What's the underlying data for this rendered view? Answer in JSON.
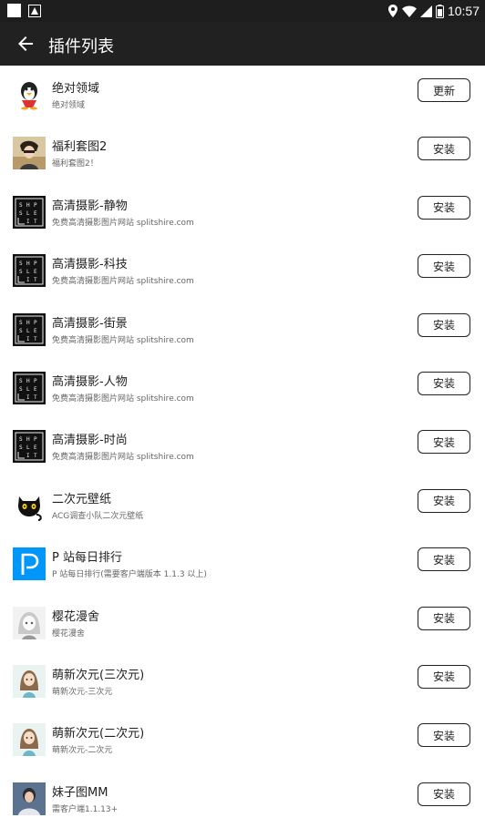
{
  "status_bar": {
    "time": "10:57"
  },
  "toolbar": {
    "title": "插件列表"
  },
  "plugins": [
    {
      "name": "绝对领域",
      "desc": "绝对领域",
      "action": "更新",
      "icon": "penguin-icon"
    },
    {
      "name": "福利套图2",
      "desc": "福利套图2！",
      "action": "安装",
      "icon": "photo-girl-icon"
    },
    {
      "name": "高清摄影-静物",
      "desc": "免费高清摄影图片网站 splitshire.com",
      "action": "安装",
      "icon": "splitshire-logo-icon"
    },
    {
      "name": "高清摄影-科技",
      "desc": "免费高清摄影图片网站 splitshire.com",
      "action": "安装",
      "icon": "splitshire-logo-icon"
    },
    {
      "name": "高清摄影-街景",
      "desc": "免费高清摄影图片网站 splitshire.com",
      "action": "安装",
      "icon": "splitshire-logo-icon"
    },
    {
      "name": "高清摄影-人物",
      "desc": "免费高清摄影图片网站 splitshire.com",
      "action": "安装",
      "icon": "splitshire-logo-icon"
    },
    {
      "name": "高清摄影-时尚",
      "desc": "免费高清摄影图片网站 splitshire.com",
      "action": "安装",
      "icon": "splitshire-logo-icon"
    },
    {
      "name": "二次元壁纸",
      "desc": "ACG调查小队二次元壁纸",
      "action": "安装",
      "icon": "black-cat-icon"
    },
    {
      "name": "P 站每日排行",
      "desc": "P 站每日排行(需要客户端版本 1.1.3 以上)",
      "action": "安装",
      "icon": "pixiv-p-icon"
    },
    {
      "name": "樱花漫舍",
      "desc": "樱花漫舍",
      "action": "安装",
      "icon": "anime-girl-sketch-icon"
    },
    {
      "name": "萌新次元(三次元)",
      "desc": "萌新次元-三次元",
      "action": "安装",
      "icon": "anime-girl-icon"
    },
    {
      "name": "萌新次元(二次元)",
      "desc": "萌新次元-二次元",
      "action": "安装",
      "icon": "anime-girl-icon"
    },
    {
      "name": "妹子图MM",
      "desc": "需客户端1.1.13+",
      "action": "安装",
      "icon": "girl-photo-icon"
    }
  ]
}
